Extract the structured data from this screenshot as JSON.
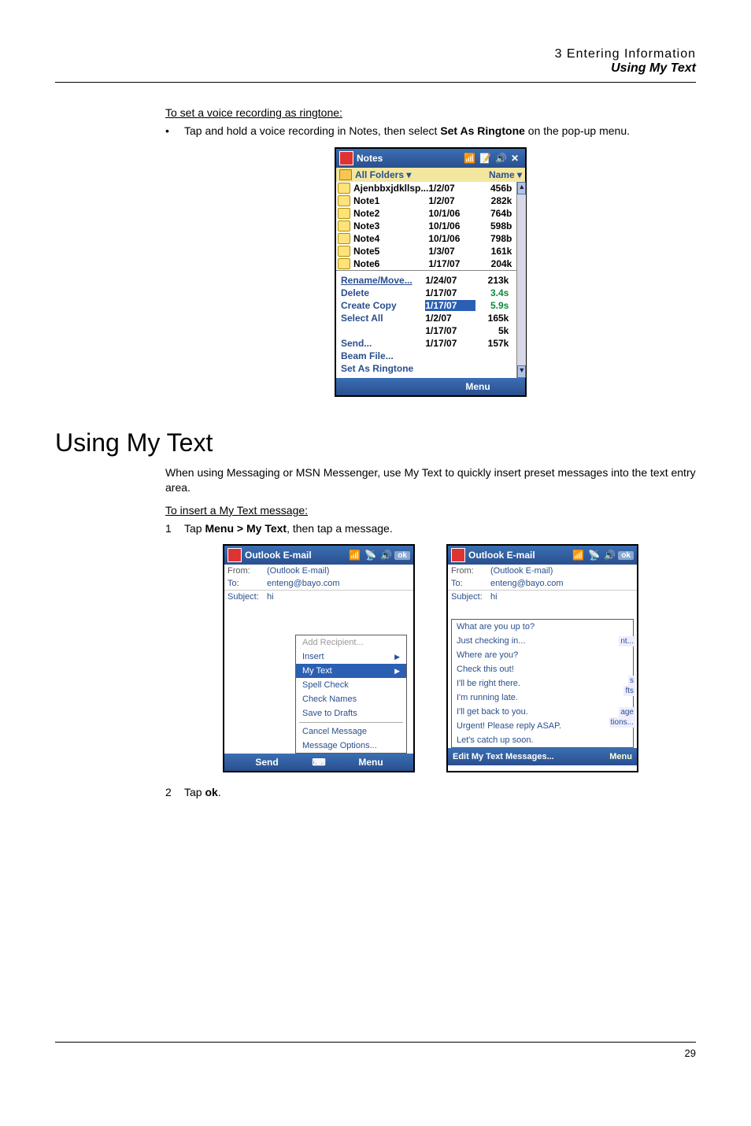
{
  "header": {
    "chapter": "3 Entering Information",
    "section": "Using My Text"
  },
  "ringtone": {
    "heading": "To set a voice recording as ringtone:",
    "step_pre": "Tap and hold a voice recording in Notes, then select ",
    "step_bold": "Set As Ringtone",
    "step_post": " on the pop-up menu."
  },
  "notes_mock": {
    "title": "Notes",
    "folders_label": "All Folders",
    "sort_label": "Name",
    "rows": [
      {
        "name": "Ajenbbxjdkllsp...",
        "date": "1/2/07",
        "size": "456b"
      },
      {
        "name": "Note1",
        "date": "1/2/07",
        "size": "282k"
      },
      {
        "name": "Note2",
        "date": "10/1/06",
        "size": "764b"
      },
      {
        "name": "Note3",
        "date": "10/1/06",
        "size": "598b"
      },
      {
        "name": "Note4",
        "date": "10/1/06",
        "size": "798b"
      },
      {
        "name": "Note5",
        "date": "1/3/07",
        "size": "161k"
      },
      {
        "name": "Note6",
        "date": "1/17/07",
        "size": "204k"
      }
    ],
    "ctx": [
      {
        "label": "Rename/Move...",
        "date": "1/24/07",
        "size": "213k",
        "sel": true
      },
      {
        "label": "Delete",
        "date": "1/17/07",
        "size": "3.4s",
        "green": true
      },
      {
        "label": "Create Copy",
        "date": "1/17/07",
        "size": "5.9s",
        "green": true,
        "hl_date": true
      },
      {
        "label": "Select All",
        "date": "1/2/07",
        "size": "165k"
      },
      {
        "label": "",
        "date": "1/17/07",
        "size": "5k"
      },
      {
        "label": "Send...",
        "date": "1/17/07",
        "size": "157k"
      },
      {
        "label": "Beam File..."
      },
      {
        "label": "Set As Ringtone"
      }
    ],
    "menu_label": "Menu"
  },
  "mytext": {
    "title": "Using My Text",
    "para": "When using Messaging or MSN Messenger, use My Text to quickly insert preset messages into the text entry area.",
    "insert_heading": "To insert a My Text message:",
    "step1_pre": "Tap ",
    "step1_bold": "Menu > My Text",
    "step1_post": ", then tap a message.",
    "step2_pre": "Tap ",
    "step2_bold": "ok",
    "step2_post": "."
  },
  "outlook_left": {
    "title": "Outlook E-mail",
    "from_label": "From:",
    "from_value": "(Outlook E-mail)",
    "to_label": "To:",
    "to_value": "enteng@bayo.com",
    "subject_label": "Subject:",
    "subject_value": "hi",
    "menu": [
      {
        "label": "Add Recipient...",
        "disabled": true
      },
      {
        "label": "Insert",
        "arrow": true
      },
      {
        "label": "My Text",
        "arrow": true,
        "sel": true
      },
      {
        "label": "Spell Check"
      },
      {
        "label": "Check Names"
      },
      {
        "label": "Save to Drafts"
      },
      {
        "sep": true
      },
      {
        "label": "Cancel Message"
      },
      {
        "label": "Message Options..."
      }
    ],
    "soft_left": "Send",
    "soft_right": "Menu",
    "ok": "ok"
  },
  "outlook_right": {
    "title": "Outlook E-mail",
    "from_label": "From:",
    "from_value": "(Outlook E-mail)",
    "to_label": "To:",
    "to_value": "enteng@bayo.com",
    "subject_label": "Subject:",
    "subject_value": "hi",
    "items": [
      "What are you up to?",
      "Just checking in...",
      "Where are you?",
      "Check this out!",
      "I'll be right there.",
      "I'm running late.",
      "I'll get back to you.",
      "Urgent! Please reply ASAP.",
      "Let's catch up soon."
    ],
    "edit_label": "Edit My Text Messages...",
    "frag1": "nt...",
    "frag2": "s",
    "frag3": "fts",
    "frag4": "age",
    "frag5": "tions...",
    "frag_menu": "Menu",
    "ok": "ok"
  },
  "page_number": "29"
}
